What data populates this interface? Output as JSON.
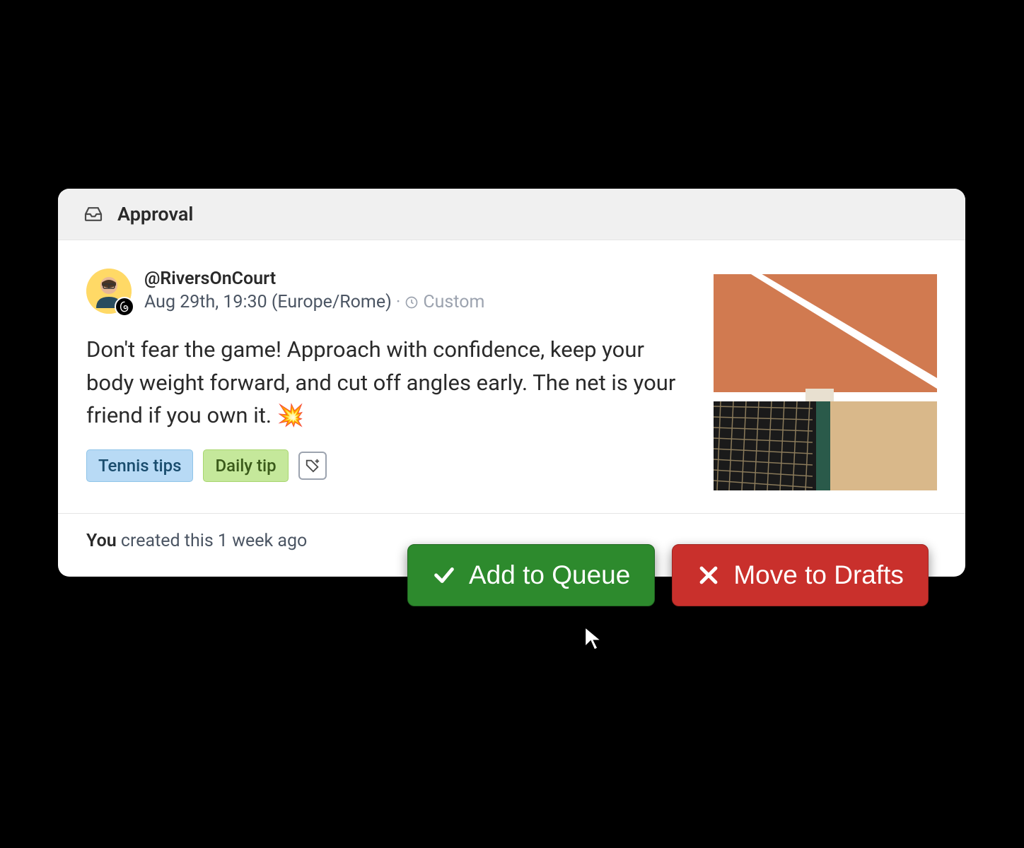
{
  "header": {
    "title": "Approval"
  },
  "post": {
    "handle": "@RiversOnCourt",
    "date": "Aug 29th, 19:30 (Europe/Rome)",
    "schedule_type": "Custom",
    "body": "Don't fear the game! Approach with confidence, keep your body weight forward, and cut off angles early. The net is your friend if you own it. 💥",
    "tags": [
      "Tennis tips",
      "Daily tip"
    ],
    "tag_colors": [
      "blue",
      "green"
    ]
  },
  "footer": {
    "you": "You",
    "created_text": " created this 1 week ago"
  },
  "actions": {
    "approve_label": "Add to Queue",
    "reject_label": "Move to Drafts"
  }
}
